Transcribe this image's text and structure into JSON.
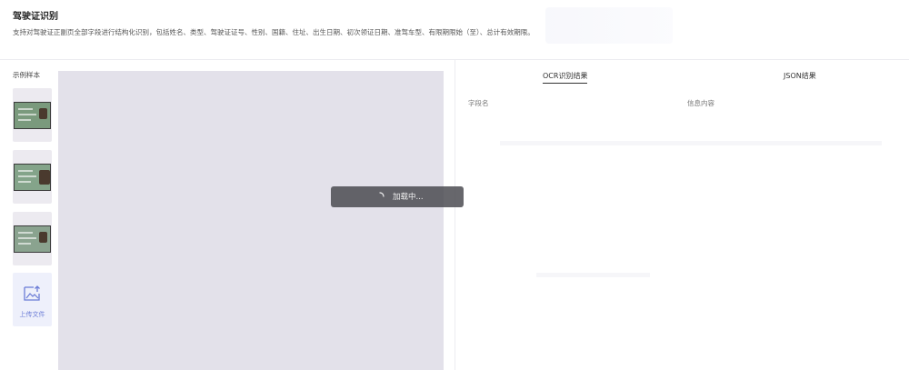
{
  "header": {
    "title": "驾驶证识别",
    "description": "支持对驾驶证正副页全部字段进行结构化识别，包括姓名、类型、驾驶证证号、性别、国籍、住址、出生日期、初次领证日期、准驾车型、有限期限始（至）、总计有效期限。"
  },
  "samples": {
    "label": "示例样本",
    "thumbnails": [
      {
        "name": "sample-1",
        "card_color": "#7a9a7d"
      },
      {
        "name": "sample-2",
        "card_color": "#84a48a"
      },
      {
        "name": "sample-3",
        "card_color": "#8aa38f"
      }
    ],
    "upload_label": "上传文件",
    "upload_icon": "image-upload-icon"
  },
  "preview": {
    "loading_text": "加载中..."
  },
  "result": {
    "tabs": [
      {
        "label": "OCR识别结果",
        "active": true
      },
      {
        "label": "JSON结果",
        "active": false
      }
    ],
    "columns": {
      "field": "字段名",
      "info": "信息内容"
    }
  },
  "colors": {
    "accent": "#6a7bd6",
    "preview_bg": "#e3e1ea",
    "loading_bg": "#4a4a50"
  }
}
